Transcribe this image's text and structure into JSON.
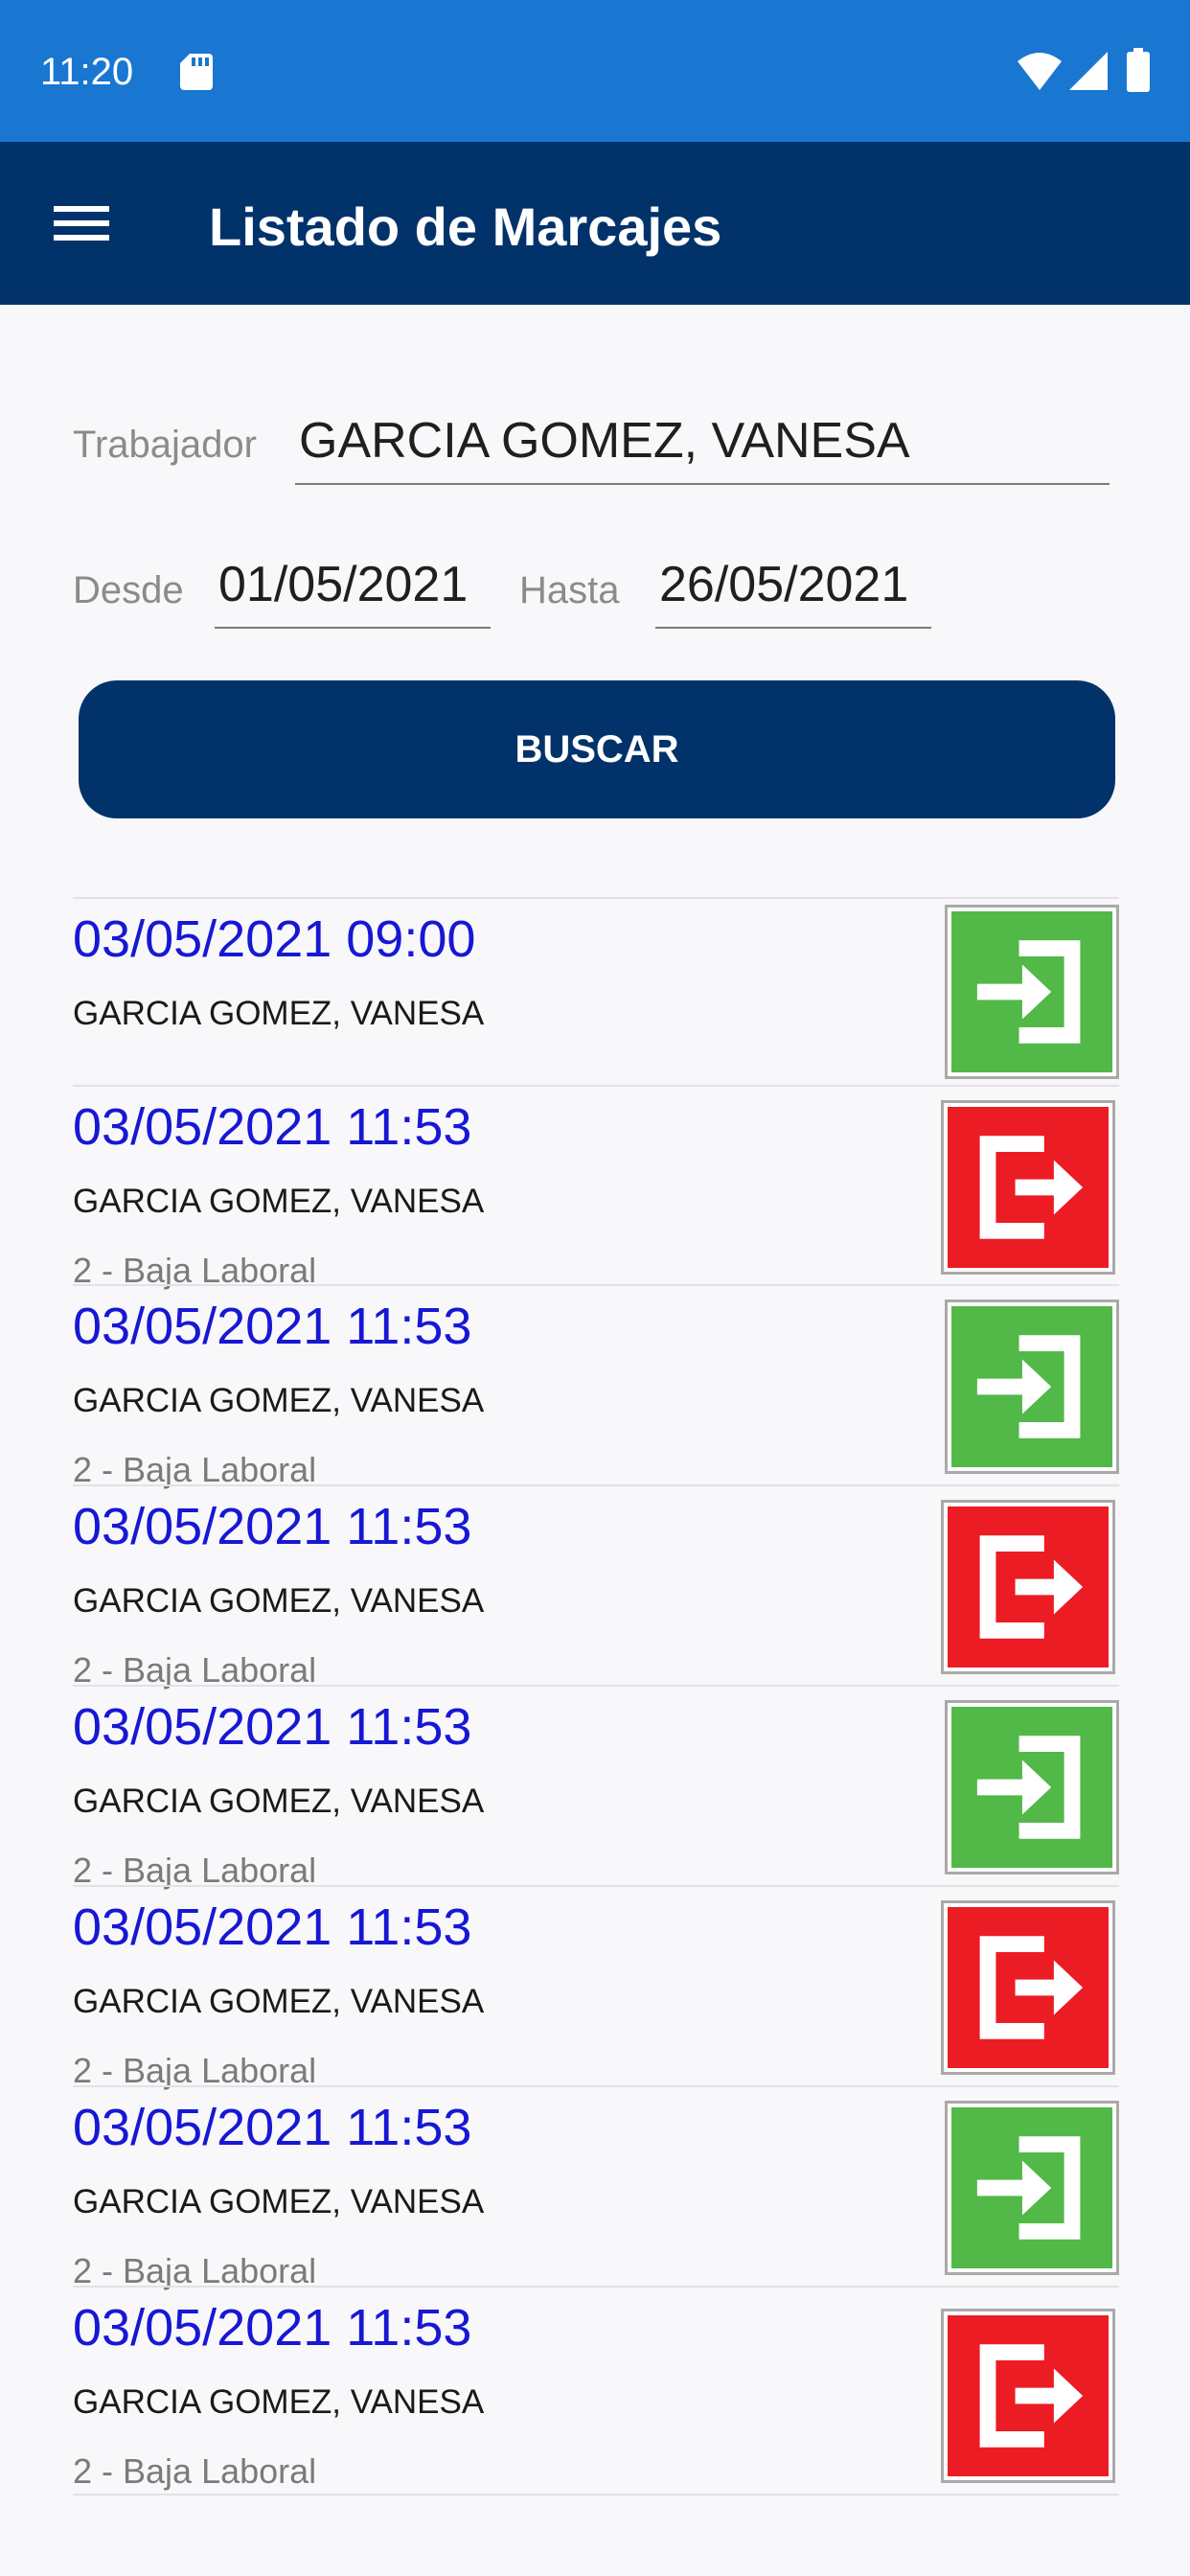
{
  "status_bar": {
    "time": "11:20",
    "icons": [
      "sd-card-icon",
      "wifi-icon",
      "cell-signal-icon",
      "battery-icon"
    ]
  },
  "app_bar": {
    "title": "Listado de Marcajes",
    "menu_icon": "menu-icon",
    "color": "#01336a"
  },
  "form": {
    "worker_label": "Trabajador",
    "worker_value": "GARCIA GOMEZ, VANESA",
    "from_label": "Desde",
    "from_value": "01/05/2021",
    "to_label": "Hasta",
    "to_value": "26/05/2021",
    "search_label": "BUSCAR"
  },
  "colors": {
    "status_bar": "#1977d2",
    "accent": "#01336a",
    "date_text": "#1717d4",
    "entry_green": "#52b848",
    "exit_red": "#ec1c24"
  },
  "records": [
    {
      "datetime": "03/05/2021 09:00",
      "worker": "GARCIA GOMEZ, VANESA",
      "reason": "",
      "type": "entry",
      "icon": "entry-arrow-icon"
    },
    {
      "datetime": "03/05/2021 11:53",
      "worker": "GARCIA GOMEZ, VANESA",
      "reason": "2 - Baja Laboral",
      "type": "exit",
      "icon": "exit-arrow-icon"
    },
    {
      "datetime": "03/05/2021 11:53",
      "worker": "GARCIA GOMEZ, VANESA",
      "reason": "2 - Baja Laboral",
      "type": "entry",
      "icon": "entry-arrow-icon"
    },
    {
      "datetime": "03/05/2021 11:53",
      "worker": "GARCIA GOMEZ, VANESA",
      "reason": "2 - Baja Laboral",
      "type": "exit",
      "icon": "exit-arrow-icon"
    },
    {
      "datetime": "03/05/2021 11:53",
      "worker": "GARCIA GOMEZ, VANESA",
      "reason": "2 - Baja Laboral",
      "type": "entry",
      "icon": "entry-arrow-icon"
    },
    {
      "datetime": "03/05/2021 11:53",
      "worker": "GARCIA GOMEZ, VANESA",
      "reason": "2 - Baja Laboral",
      "type": "exit",
      "icon": "exit-arrow-icon"
    },
    {
      "datetime": "03/05/2021 11:53",
      "worker": "GARCIA GOMEZ, VANESA",
      "reason": "2 - Baja Laboral",
      "type": "entry",
      "icon": "entry-arrow-icon"
    },
    {
      "datetime": "03/05/2021 11:53",
      "worker": "GARCIA GOMEZ, VANESA",
      "reason": "2 - Baja Laboral",
      "type": "exit",
      "icon": "exit-arrow-icon"
    }
  ]
}
